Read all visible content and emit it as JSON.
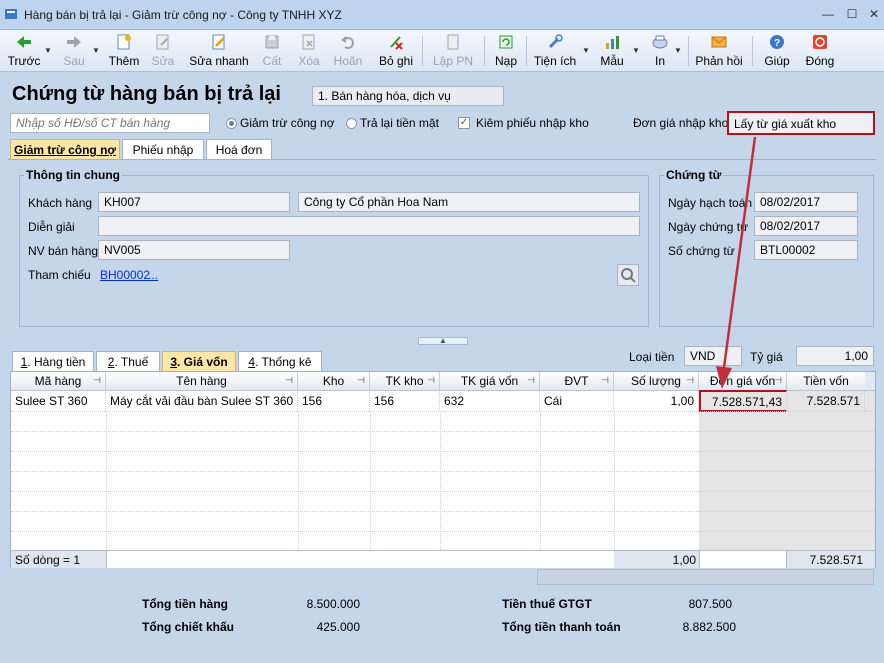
{
  "window": {
    "title": "Hàng bán bị trả lại - Giảm trừ công nợ - Công ty TNHH XYZ"
  },
  "toolbar": {
    "items": [
      {
        "label": "Trước",
        "icon": "arrow-left-icon"
      },
      {
        "label": "Sau",
        "icon": "arrow-right-icon"
      },
      {
        "label": "Thêm",
        "icon": "add-doc-icon"
      },
      {
        "label": "Sửa",
        "icon": "edit-doc-icon"
      },
      {
        "label": "Sửa nhanh",
        "icon": "quick-edit-icon"
      },
      {
        "label": "Cất",
        "icon": "save-icon"
      },
      {
        "label": "Xóa",
        "icon": "delete-icon"
      },
      {
        "label": "Hoãn",
        "icon": "undo-icon"
      },
      {
        "label": "Bỏ ghi",
        "icon": "unpost-icon"
      },
      {
        "label": "Lập PN",
        "icon": "create-receipt-icon"
      },
      {
        "label": "Nạp",
        "icon": "refresh-icon"
      },
      {
        "label": "Tiện ích",
        "icon": "tools-icon"
      },
      {
        "label": "Mẫu",
        "icon": "template-icon"
      },
      {
        "label": "In",
        "icon": "print-icon"
      },
      {
        "label": "Phản hồi",
        "icon": "mail-icon"
      },
      {
        "label": "Giúp",
        "icon": "help-icon"
      },
      {
        "label": "Đóng",
        "icon": "close-icon"
      }
    ]
  },
  "header": {
    "page_title": "Chứng từ hàng bán bị trả lại",
    "type_value": "1. Bán hàng hóa, dịch vụ",
    "search_placeholder": "Nhập số HĐ/số CT bán hàng",
    "radio_reduce": "Giảm trừ công nợ",
    "radio_cash": "Trả lại tiền mặt",
    "check_receipt": "Kiêm phiếu nhập kho",
    "unit_price_label": "Đơn giá nhập kho",
    "unit_price_value": "Lấy từ giá xuất kho"
  },
  "top_tabs": [
    "Giảm trừ công nợ",
    "Phiếu nhập",
    "Hoá đơn"
  ],
  "general": {
    "title": "Thông tin chung",
    "customer_label": "Khách hàng",
    "customer_code": "KH007",
    "customer_name": "Công ty Cổ phần Hoa Nam",
    "desc_label": "Diễn giải",
    "desc_value": "",
    "staff_label": "NV bán hàng",
    "staff_value": "NV005",
    "ref_label": "Tham chiếu",
    "ref_value": "BH00002",
    "ref_more": "..."
  },
  "voucher": {
    "title": "Chứng từ",
    "posting_date_label": "Ngày hạch toán",
    "posting_date": "08/02/2017",
    "voucher_date_label": "Ngày chứng từ",
    "voucher_date": "08/02/2017",
    "voucher_no_label": "Số chứng từ",
    "voucher_no": "BTL00002"
  },
  "detail_tabs": [
    {
      "num": "1",
      "label": ". Hàng tiền"
    },
    {
      "num": "2",
      "label": ". Thuế"
    },
    {
      "num": "3",
      "label": ". Giá vốn"
    },
    {
      "num": "4",
      "label": ". Thống kê"
    }
  ],
  "currency": {
    "label": "Loại tiền",
    "value": "VND",
    "rate_label": "Tỷ giá",
    "rate_value": "1,00"
  },
  "grid": {
    "headers": [
      "Mã hàng",
      "Tên hàng",
      "Kho",
      "TK kho",
      "TK giá vốn",
      "ĐVT",
      "Số lượng",
      "Đơn giá vốn",
      "Tiền vốn"
    ],
    "rows": [
      [
        "Sulee ST 360",
        "Máy cắt vải đầu bàn Sulee ST 360",
        "156",
        "156",
        "632",
        "Cái",
        "1,00",
        "7.528.571,43",
        "7.528.571"
      ]
    ],
    "footer_count": "Số dòng = 1",
    "footer_qty": "1,00",
    "footer_amount": "7.528.571"
  },
  "totals": {
    "goods_label": "Tổng tiền hàng",
    "goods_value": "8.500.000",
    "discount_label": "Tổng chiết khấu",
    "discount_value": "425.000",
    "vat_label": "Tiền thuế GTGT",
    "vat_value": "807.500",
    "payment_label": "Tổng tiền thanh toán",
    "payment_value": "8.882.500"
  },
  "colors": {
    "highlight_red": "#b0111a",
    "active_tab": "#fbe6a8",
    "background": "#c6d6ea"
  }
}
